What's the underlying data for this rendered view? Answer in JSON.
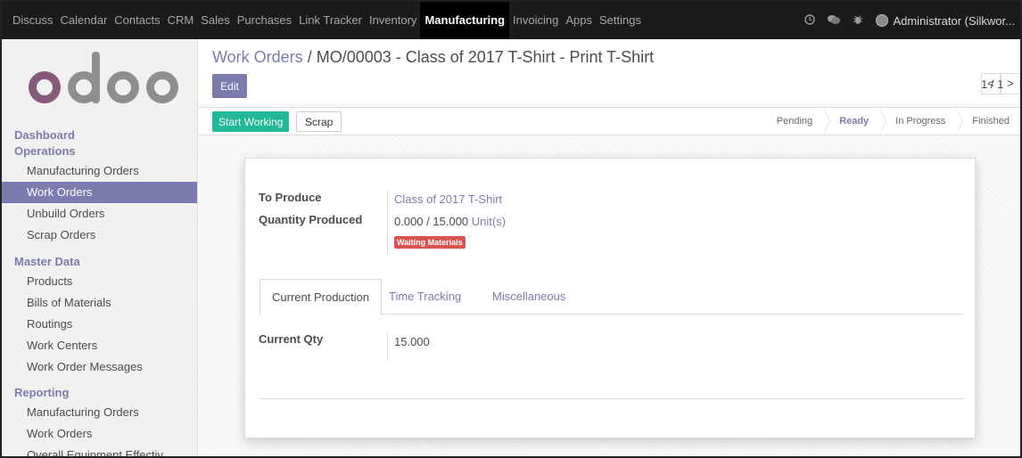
{
  "topbar": {
    "menu": [
      "Discuss",
      "Calendar",
      "Contacts",
      "CRM",
      "Sales",
      "Purchases",
      "Link Tracker",
      "Inventory",
      "Manufacturing",
      "Invoicing",
      "Apps",
      "Settings"
    ],
    "active_menu": "Manufacturing",
    "icons": [
      "clock-icon",
      "chat-icon",
      "bug-icon"
    ],
    "user": "Administrator (Silkwor..."
  },
  "sidebar": {
    "sections": [
      {
        "title": "Dashboard"
      },
      {
        "title": "Operations",
        "items": [
          "Manufacturing Orders",
          "Work Orders",
          "Unbuild Orders",
          "Scrap Orders"
        ]
      },
      {
        "title": "Master Data",
        "items": [
          "Products",
          "Bills of Materials",
          "Routings",
          "Work Centers",
          "Work Order Messages"
        ]
      },
      {
        "title": "Reporting",
        "items": [
          "Manufacturing Orders",
          "Work Orders",
          "Overall Equipment Effectiv..."
        ]
      }
    ],
    "active_item": "Work Orders"
  },
  "breadcrumb": {
    "parent": "Work Orders",
    "separator": " / ",
    "current": "MO/00003 - Class of 2017 T-Shirt - Print T-Shirt"
  },
  "buttons": {
    "edit": "Edit",
    "start_working": "Start Working",
    "scrap": "Scrap"
  },
  "pager": {
    "value": "1 / 1",
    "prev": "<",
    "next": ">"
  },
  "stages": [
    "Pending",
    "Ready",
    "In Progress",
    "Finished"
  ],
  "active_stage": "Ready",
  "form": {
    "to_produce_label": "To Produce",
    "to_produce_value": "Class of 2017 T-Shirt",
    "qty_label": "Quantity Produced",
    "qty_produced": "0.000",
    "qty_sep": " / ",
    "qty_total": "15.000",
    "qty_unit": "Unit(s)",
    "status_badge": "Waiting Materials",
    "tabs": [
      "Current Production",
      "Time Tracking",
      "Miscellaneous"
    ],
    "active_tab": "Current Production",
    "current_qty_label": "Current Qty",
    "current_qty_value": "15.000"
  },
  "colors": {
    "accent": "#7c7bad",
    "start": "#21b799",
    "badge": "#d9534f",
    "navbar": "#1b1b1b"
  }
}
